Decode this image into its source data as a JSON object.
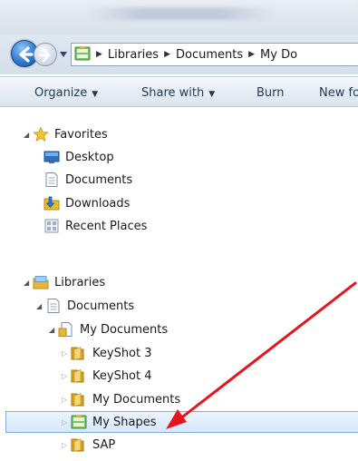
{
  "window": {
    "address_crumbs": [
      "Libraries",
      "Documents",
      "My Do"
    ]
  },
  "toolbar": {
    "organize_label": "Organize",
    "share_label": "Share with",
    "burn_label": "Burn",
    "newfolder_label": "New fo"
  },
  "tree": {
    "favorites": {
      "label": "Favorites",
      "items": [
        "Desktop",
        "Documents",
        "Downloads",
        "Recent Places"
      ]
    },
    "libraries": {
      "label": "Libraries",
      "documents_label": "Documents",
      "my_documents_label": "My Documents",
      "children": [
        "KeyShot 3",
        "KeyShot 4",
        "My Documents",
        "My Shapes",
        "SAP"
      ]
    },
    "selected_item": "My Shapes"
  },
  "colors": {
    "annotation_arrow": "#e8141c",
    "selection_border": "#84acdd",
    "toolbar_text": "#1e395b",
    "folder_yellow": "#e8b930"
  },
  "icons": {
    "back": "arrow-left-icon",
    "forward": "arrow-right-icon",
    "favorites": "star-icon",
    "desktop": "desktop-icon",
    "documents": "document-icon",
    "downloads": "downloads-folder-icon",
    "recent": "recent-places-icon",
    "libraries": "library-icon",
    "folder": "folder-icon",
    "shapes": "shapes-folder-icon"
  }
}
